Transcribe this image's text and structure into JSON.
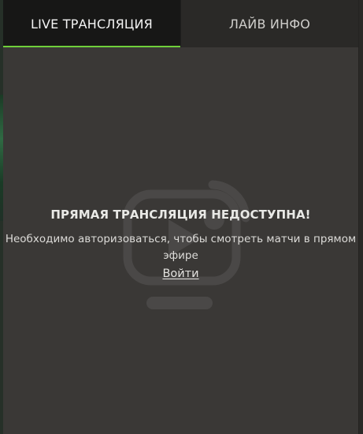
{
  "tabs": [
    {
      "label": "LIVE ТРАНСЛЯЦИЯ",
      "active": true
    },
    {
      "label": "ЛАЙВ ИНФО",
      "active": false
    }
  ],
  "message": {
    "title": "ПРЯМАЯ ТРАНСЛЯЦИЯ НЕДОСТУПНА!",
    "text": "Необходимо авторизоваться, чтобы смотреть матчи в прямом эфире",
    "login_link": "Войти"
  },
  "icons": {
    "background": "live-tv-icon"
  },
  "colors": {
    "accent": "#6fcf3a",
    "active_tab_bg": "#171716",
    "inactive_tab_bg": "#2a2927",
    "content_bg": "#3a3836"
  }
}
